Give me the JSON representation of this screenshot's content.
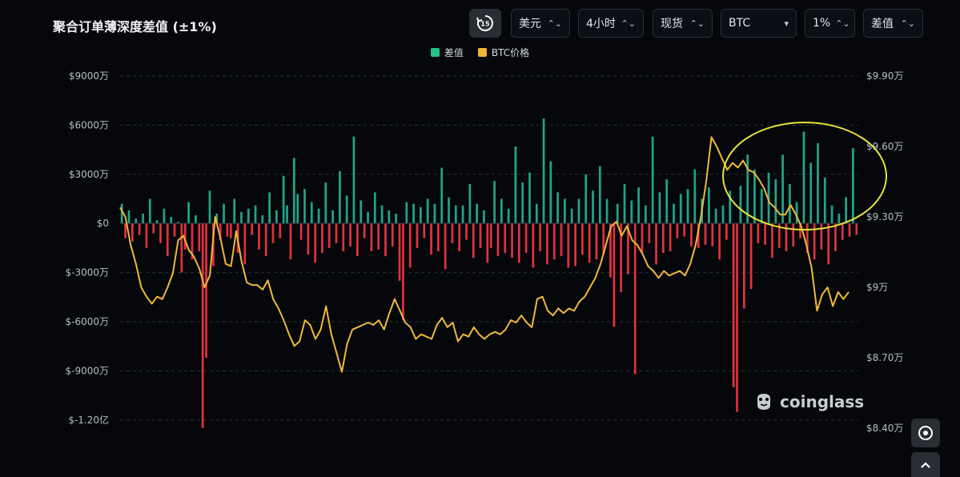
{
  "header": {
    "title": "聚合订单薄深度差值 (±1%)",
    "refresh_badge": "15",
    "controls": [
      {
        "label": "美元",
        "arrow": "⌃⌄"
      },
      {
        "label": "4小时",
        "arrow": "⌃⌄"
      },
      {
        "label": "现货",
        "arrow": "⌃⌄"
      },
      {
        "label": "BTC",
        "arrow": "▾"
      },
      {
        "label": "1%",
        "arrow": "⌃⌄"
      },
      {
        "label": "差值",
        "arrow": "⌃⌄"
      }
    ]
  },
  "legend": [
    {
      "label": "差值",
      "color": "#22c28b"
    },
    {
      "label": "BTC价格",
      "color": "#f0b93a"
    }
  ],
  "brand": "coinglass",
  "colors": {
    "positive_bar": "#1fa587",
    "negative_bar": "#e0323d",
    "price_line": "#f0b93a",
    "grid": "#2b2f36",
    "annotation": "#e6e33a"
  },
  "chart_data": {
    "type": "bar",
    "title": "聚合订单薄深度差值 (±1%)",
    "series": [
      {
        "name": "差值",
        "axis": "left",
        "unit": "万美元",
        "values": [
          1200,
          -900,
          800,
          -1100,
          300,
          -700,
          600,
          -1500,
          1500,
          -600,
          200,
          -1200,
          900,
          -2000,
          400,
          -800,
          100,
          -3000,
          -1600,
          1300,
          -2200,
          500,
          -1700,
          -12500,
          -8200,
          2000,
          -2600,
          600,
          -1000,
          1200,
          -800,
          -900,
          1500,
          -1800,
          700,
          -2500,
          900,
          -700,
          1100,
          -1600,
          500,
          -2000,
          1900,
          -1200,
          800,
          -900,
          2900,
          1100,
          -2200,
          4000,
          1800,
          -1000,
          2100,
          -1900,
          1300,
          -2400,
          900,
          -1800,
          2500,
          -1500,
          800,
          -1200,
          3200,
          -1700,
          1700,
          -1400,
          5300,
          -2000,
          1400,
          -900,
          700,
          -1700,
          1900,
          -1600,
          1100,
          -2000,
          800,
          -1400,
          600,
          -3500,
          -5900,
          1300,
          -2700,
          1200,
          -1500,
          1000,
          -900,
          1500,
          -1900,
          1200,
          -1700,
          3400,
          -2800,
          1600,
          -1200,
          1100,
          -1700,
          1100,
          -1000,
          2400,
          -2100,
          1200,
          -1500,
          800,
          -2400,
          -1500,
          2600,
          -2000,
          1500,
          -1800,
          900,
          -2100,
          4700,
          -2400,
          2500,
          -1800,
          3100,
          -2700,
          1200,
          -1700,
          6400,
          -2500,
          3800,
          -2200,
          1900,
          -2000,
          1500,
          -2700,
          900,
          -2600,
          1500,
          -1900,
          3000,
          -2400,
          2000,
          -2200,
          3500,
          -1900,
          1500,
          -3300,
          -6300,
          1200,
          -4200,
          2400,
          -3100,
          1400,
          -9200,
          2200,
          -1800,
          1100,
          -1200,
          5300,
          -2500,
          1900,
          -1800,
          2700,
          -1700,
          1200,
          -900,
          1800,
          -800,
          2100,
          -1400,
          3300,
          -1500,
          1500,
          -1300,
          2200,
          -1400,
          900,
          -2200,
          1100,
          -1000,
          2000,
          -10000,
          -11500,
          2300,
          -5200,
          4200,
          -4000,
          3300,
          -1200,
          2100,
          -1300,
          3100,
          -2100,
          2700,
          -1500,
          4200,
          -1700,
          2400,
          -1400,
          1300,
          -900,
          5600,
          -1800,
          3700,
          -2200,
          4900,
          -1600,
          2800,
          -2500,
          1100,
          -1700,
          600,
          -1000,
          1600,
          -800,
          4600,
          -700
        ]
      },
      {
        "name": "BTC价格",
        "axis": "right",
        "unit": "万美元",
        "values": [
          9.34,
          9.3,
          9.18,
          9.1,
          9.0,
          8.96,
          8.93,
          8.96,
          8.95,
          9.0,
          9.06,
          9.2,
          9.22,
          9.16,
          9.13,
          9.08,
          9.0,
          9.05,
          9.3,
          9.21,
          9.1,
          9.09,
          9.24,
          9.11,
          9.02,
          9.01,
          9.01,
          8.99,
          9.03,
          8.95,
          8.91,
          8.86,
          8.8,
          8.75,
          8.77,
          8.86,
          8.84,
          8.78,
          8.82,
          8.92,
          8.8,
          8.72,
          8.64,
          8.76,
          8.82,
          8.83,
          8.84,
          8.85,
          8.84,
          8.86,
          8.82,
          8.89,
          8.95,
          8.9,
          8.85,
          8.83,
          8.78,
          8.8,
          8.79,
          8.78,
          8.84,
          8.87,
          8.83,
          8.85,
          8.77,
          8.8,
          8.79,
          8.83,
          8.8,
          8.78,
          8.8,
          8.81,
          8.8,
          8.82,
          8.86,
          8.85,
          8.88,
          8.85,
          8.83,
          8.95,
          8.96,
          8.9,
          8.88,
          8.91,
          8.89,
          8.91,
          8.9,
          8.94,
          8.96,
          9.0,
          9.04,
          9.1,
          9.18,
          9.26,
          9.28,
          9.22,
          9.26,
          9.2,
          9.18,
          9.14,
          9.09,
          9.07,
          9.04,
          9.07,
          9.05,
          9.06,
          9.07,
          9.05,
          9.1,
          9.18,
          9.3,
          9.45,
          9.64,
          9.6,
          9.55,
          9.5,
          9.53,
          9.51,
          9.54,
          9.5,
          9.49,
          9.46,
          9.42,
          9.36,
          9.34,
          9.31,
          9.31,
          9.35,
          9.31,
          9.26,
          9.18,
          9.08,
          8.9,
          8.97,
          9.0,
          8.92,
          8.98,
          8.95,
          8.98
        ]
      }
    ],
    "y_left": {
      "ticks": [
        "$9000万",
        "$6000万",
        "$3000万",
        "$0",
        "$-3000万",
        "$-6000万",
        "$-9000万",
        "$-1.20亿"
      ],
      "range": [
        -12500,
        9000
      ]
    },
    "y_right": {
      "ticks": [
        "$9.90万",
        "$9.60万",
        "$9.30万",
        "$9万",
        "$8.70万",
        "$8.40万"
      ],
      "range": [
        8.4,
        9.9
      ]
    },
    "grid": "dashed-horizontal",
    "legend_position": "top-center",
    "annotation": "yellow ellipse around recent positive bars"
  }
}
